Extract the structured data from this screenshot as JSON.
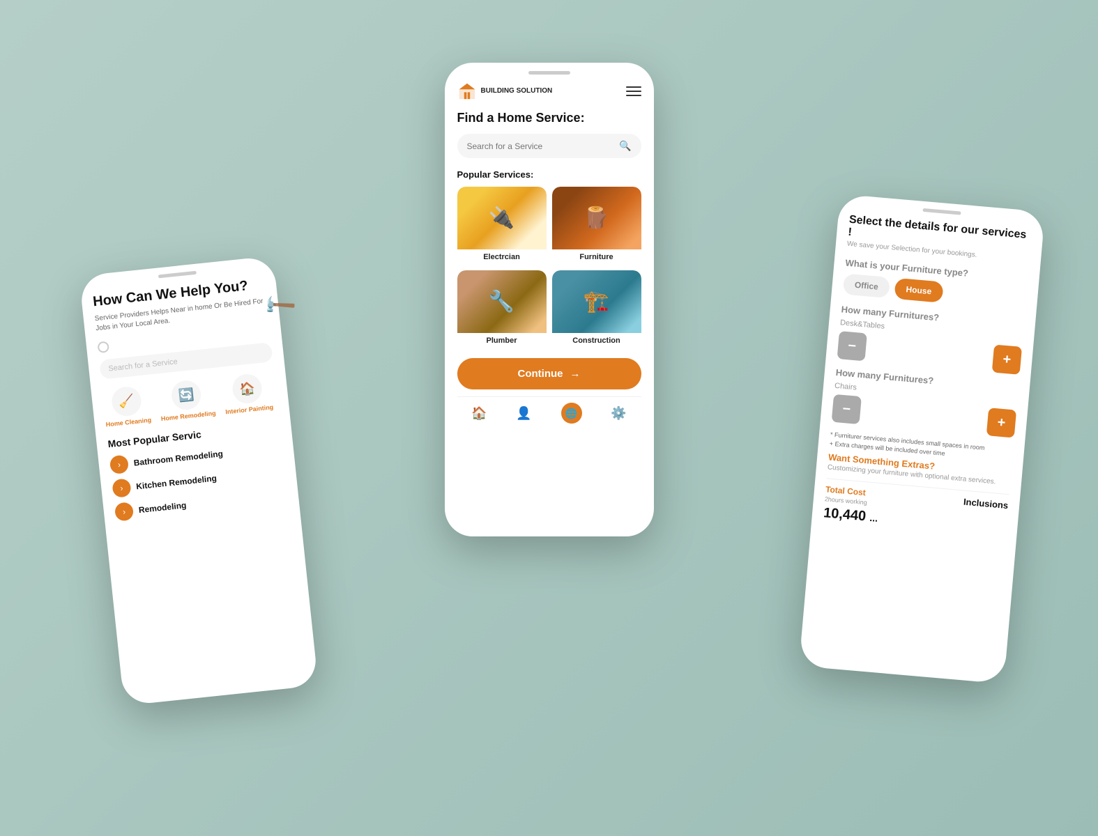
{
  "background": {
    "color": "#a8c4bb"
  },
  "center_phone": {
    "logo": {
      "icon_label": "building-icon",
      "brand_name": "BUILDING\nSOLUTION"
    },
    "hamburger_label": "menu",
    "page_title": "Find a Home Service:",
    "search_placeholder": "Search for a Service",
    "popular_services_label": "Popular Services:",
    "services": [
      {
        "id": "electrician",
        "name": "Electrcian",
        "img_class": "img-electrician"
      },
      {
        "id": "furniture",
        "name": "Furniture",
        "img_class": "img-furniture"
      },
      {
        "id": "plumber",
        "name": "Plumber",
        "img_class": "img-plumber"
      },
      {
        "id": "construction",
        "name": "Construction",
        "img_class": "img-construction"
      }
    ],
    "continue_button": "Continue",
    "nav_items": [
      {
        "id": "home",
        "icon": "🏠",
        "active": true
      },
      {
        "id": "profile",
        "icon": "👤",
        "active": false
      },
      {
        "id": "globe",
        "icon": "🌐",
        "active": false
      },
      {
        "id": "settings",
        "icon": "⚙️",
        "active": false
      }
    ]
  },
  "left_phone": {
    "hero_title": "How Can We Help You?",
    "hero_subtitle": "Service Providers Helps  Near  in home Or Be\nHired For Jobs in Your Local Area.",
    "search_placeholder": "Search for a Service",
    "categories": [
      {
        "id": "home-cleaning",
        "icon": "🧹",
        "label": "Home\nCleaning"
      },
      {
        "id": "home-remodeling",
        "icon": "🔄",
        "label": "Home\nRemodeling"
      },
      {
        "id": "interior-painting",
        "icon": "🏠",
        "label": "Interior\nPainting"
      }
    ],
    "most_popular_title": "Most Popular Servic",
    "services_list": [
      {
        "id": "bathroom",
        "label": "Bathroom Remodeling"
      },
      {
        "id": "kitchen",
        "label": "Kitchen Remodeling"
      },
      {
        "id": "remodeling",
        "label": "Remodeling"
      }
    ]
  },
  "right_phone": {
    "title": "Select the details for our services !",
    "subtitle": "We save your Selection for your bookings.",
    "furniture_type_question": "What is your Furniture type?",
    "furniture_options": [
      {
        "id": "office",
        "label": "Office",
        "selected": false
      },
      {
        "id": "house",
        "label": "House",
        "selected": true
      }
    ],
    "furnitures_count_1": {
      "question": "How many Furnitures?",
      "sub_label": "Desk&Tables"
    },
    "furnitures_count_2": {
      "question": "How many Furnitures?",
      "sub_label": "Chairs"
    },
    "note_1": "* Furniturer services also includes small spaces in room",
    "note_2": "+ Extra charges will be included over time",
    "extras_title": "Want Something Extras?",
    "extras_subtitle": "Customizing your furniture with optional extra services.",
    "total_cost_label": "Total Cost",
    "total_cost_sub": "2hours working",
    "inclusions_title": "Inclusions",
    "total_price": "10,440"
  },
  "deco": {
    "hammer_icon": "🔨"
  }
}
